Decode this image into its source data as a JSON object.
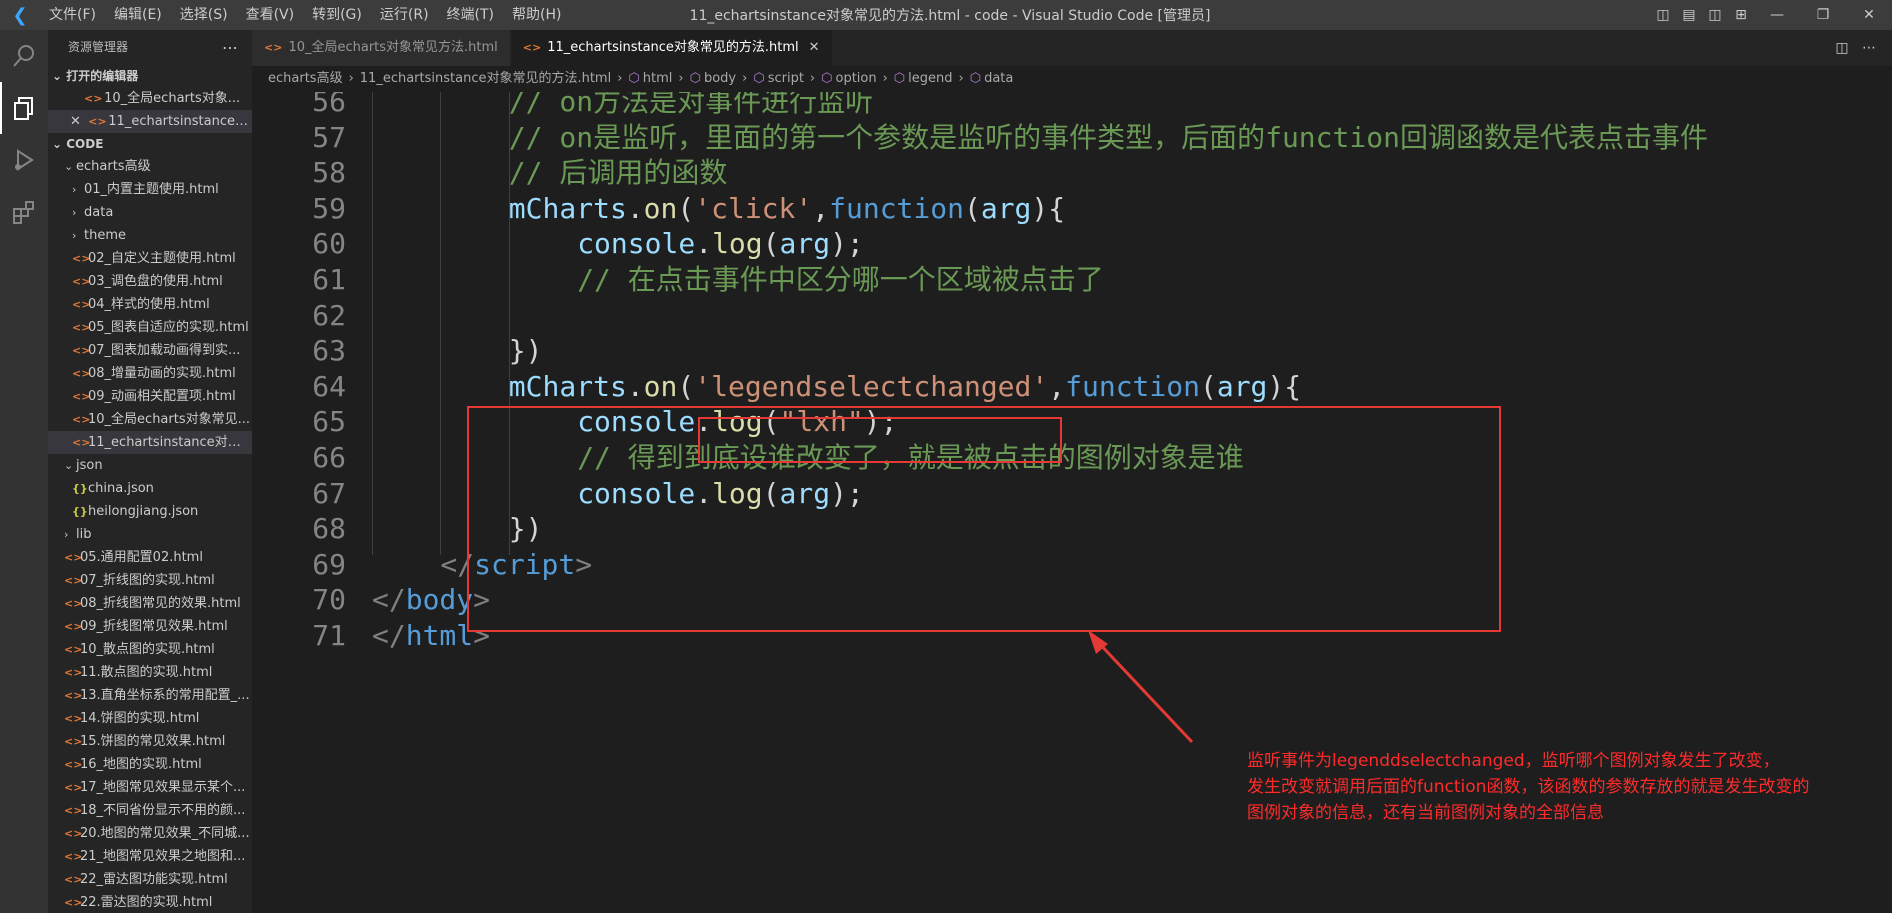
{
  "window": {
    "title": "11_echartsinstance对象常见的方法.html - code - Visual Studio Code [管理员]",
    "menu": [
      "文件(F)",
      "编辑(E)",
      "选择(S)",
      "查看(V)",
      "转到(G)",
      "运行(R)",
      "终端(T)",
      "帮助(H)"
    ]
  },
  "activity_bar": [
    "files-icon",
    "search-icon",
    "source-control-icon",
    "run-debug-icon",
    "extensions-icon"
  ],
  "sidebar": {
    "title": "资源管理器",
    "open_editors_label": "打开的编辑器",
    "open_editors": [
      "10_全局echarts对象...",
      "11_echartsinstance对..."
    ],
    "workspace_label": "CODE",
    "tree": [
      {
        "label": "echarts高级",
        "type": "folder-open",
        "indent": 1
      },
      {
        "label": "01_内置主题使用.html",
        "type": "folder-closed",
        "indent": 2
      },
      {
        "label": "data",
        "type": "folder-closed",
        "indent": 2
      },
      {
        "label": "theme",
        "type": "folder-closed",
        "indent": 2
      },
      {
        "label": "02_自定义主题使用.html",
        "type": "html",
        "indent": 2
      },
      {
        "label": "03_调色盘的使用.html",
        "type": "html",
        "indent": 2
      },
      {
        "label": "04_样式的使用.html",
        "type": "html",
        "indent": 2
      },
      {
        "label": "05_图表自适应的实现.html",
        "type": "html",
        "indent": 2
      },
      {
        "label": "07_图表加载动画得到实...",
        "type": "html",
        "indent": 2
      },
      {
        "label": "08_增量动画的实现.html",
        "type": "html",
        "indent": 2
      },
      {
        "label": "09_动画相关配置项.html",
        "type": "html",
        "indent": 2
      },
      {
        "label": "10_全局echarts对象常见...",
        "type": "html",
        "indent": 2
      },
      {
        "label": "11_echartsinstance对象...",
        "type": "html",
        "indent": 2,
        "selected": true
      },
      {
        "label": "json",
        "type": "folder-open",
        "indent": 1
      },
      {
        "label": "china.json",
        "type": "json",
        "indent": 2
      },
      {
        "label": "heilongjiang.json",
        "type": "json",
        "indent": 2
      },
      {
        "label": "lib",
        "type": "folder-closed",
        "indent": 1
      },
      {
        "label": "05.通用配置02.html",
        "type": "html",
        "indent": 1
      },
      {
        "label": "07_折线图的实现.html",
        "type": "html",
        "indent": 1
      },
      {
        "label": "08_折线图常见的效果.html",
        "type": "html",
        "indent": 1
      },
      {
        "label": "09_折线图常见效果.html",
        "type": "html",
        "indent": 1
      },
      {
        "label": "10_散点图的实现.html",
        "type": "html",
        "indent": 1
      },
      {
        "label": "11.散点图的实现.html",
        "type": "html",
        "indent": 1
      },
      {
        "label": "13.直角坐标系的常用配置_...",
        "type": "html",
        "indent": 1
      },
      {
        "label": "14.饼图的实现.html",
        "type": "html",
        "indent": 1
      },
      {
        "label": "15.饼图的常见效果.html",
        "type": "html",
        "indent": 1
      },
      {
        "label": "16_地图的实现.html",
        "type": "html",
        "indent": 1
      },
      {
        "label": "17_地图常见效果显示某个...",
        "type": "html",
        "indent": 1
      },
      {
        "label": "18_不同省份显示不用的颜...",
        "type": "html",
        "indent": 1
      },
      {
        "label": "20.地图的常见效果_不同城...",
        "type": "html",
        "indent": 1
      },
      {
        "label": "21_地图常见效果之地图和...",
        "type": "html",
        "indent": 1
      },
      {
        "label": "22_雷达图功能实现.html",
        "type": "html",
        "indent": 1
      },
      {
        "label": "22.雷达图的实现.html",
        "type": "html",
        "indent": 1
      }
    ]
  },
  "tabs": [
    {
      "label": "10_全局echarts对象常见方法.html",
      "active": false
    },
    {
      "label": "11_echartsinstance对象常见的方法.html",
      "active": true
    }
  ],
  "breadcrumb": [
    "echarts高级",
    "11_echartsinstance对象常见的方法.html",
    "html",
    "body",
    "script",
    "option",
    "legend",
    "data"
  ],
  "code_lines": [
    {
      "num": "56",
      "indent": 2,
      "tokens": [
        {
          "t": "// on方法是对事件进行监听",
          "c": "c-com"
        }
      ]
    },
    {
      "num": "57",
      "indent": 2,
      "tokens": [
        {
          "t": "// on是监听，里面的第一个参数是监听的事件类型，后面的function回调函数是代表点击事件",
          "c": "c-com"
        }
      ]
    },
    {
      "num": "58",
      "indent": 2,
      "tokens": [
        {
          "t": "// 后调用的函数",
          "c": "c-com"
        }
      ]
    },
    {
      "num": "59",
      "indent": 2,
      "tokens": [
        {
          "t": "mCharts",
          "c": "c-var"
        },
        {
          "t": ".",
          "c": "c-def"
        },
        {
          "t": "on",
          "c": "c-fn"
        },
        {
          "t": "(",
          "c": "c-def"
        },
        {
          "t": "'click'",
          "c": "c-str"
        },
        {
          "t": ",",
          "c": "c-def"
        },
        {
          "t": "function",
          "c": "c-kw"
        },
        {
          "t": "(",
          "c": "c-def"
        },
        {
          "t": "arg",
          "c": "c-var"
        },
        {
          "t": "){",
          "c": "c-def"
        }
      ]
    },
    {
      "num": "60",
      "indent": 3,
      "tokens": [
        {
          "t": "console",
          "c": "c-var"
        },
        {
          "t": ".",
          "c": "c-def"
        },
        {
          "t": "log",
          "c": "c-fn"
        },
        {
          "t": "(",
          "c": "c-def"
        },
        {
          "t": "arg",
          "c": "c-var"
        },
        {
          "t": ");",
          "c": "c-def"
        }
      ]
    },
    {
      "num": "61",
      "indent": 3,
      "tokens": [
        {
          "t": "// 在点击事件中区分哪一个区域被点击了",
          "c": "c-com"
        }
      ]
    },
    {
      "num": "62",
      "indent": 3,
      "tokens": []
    },
    {
      "num": "63",
      "indent": 2,
      "tokens": [
        {
          "t": "})",
          "c": "c-def"
        }
      ]
    },
    {
      "num": "64",
      "indent": 2,
      "tokens": [
        {
          "t": "mCharts",
          "c": "c-var"
        },
        {
          "t": ".",
          "c": "c-def"
        },
        {
          "t": "on",
          "c": "c-fn"
        },
        {
          "t": "(",
          "c": "c-def"
        },
        {
          "t": "'legendselectchanged'",
          "c": "c-str"
        },
        {
          "t": ",",
          "c": "c-def"
        },
        {
          "t": "function",
          "c": "c-kw"
        },
        {
          "t": "(",
          "c": "c-def"
        },
        {
          "t": "arg",
          "c": "c-var"
        },
        {
          "t": "){",
          "c": "c-def"
        }
      ]
    },
    {
      "num": "65",
      "indent": 3,
      "tokens": [
        {
          "t": "console",
          "c": "c-var"
        },
        {
          "t": ".",
          "c": "c-def"
        },
        {
          "t": "log",
          "c": "c-fn"
        },
        {
          "t": "(",
          "c": "c-def"
        },
        {
          "t": "\"lxh\"",
          "c": "c-str"
        },
        {
          "t": ");",
          "c": "c-def"
        }
      ]
    },
    {
      "num": "66",
      "indent": 3,
      "tokens": [
        {
          "t": "// 得到到底设谁改变了，就是被点击的图例对象是谁",
          "c": "c-com"
        }
      ]
    },
    {
      "num": "67",
      "indent": 3,
      "tokens": [
        {
          "t": "console",
          "c": "c-var"
        },
        {
          "t": ".",
          "c": "c-def"
        },
        {
          "t": "log",
          "c": "c-fn"
        },
        {
          "t": "(",
          "c": "c-def"
        },
        {
          "t": "arg",
          "c": "c-var"
        },
        {
          "t": ");",
          "c": "c-def"
        }
      ]
    },
    {
      "num": "68",
      "indent": 2,
      "tokens": [
        {
          "t": "})",
          "c": "c-def"
        }
      ]
    },
    {
      "num": "69",
      "indent": 1,
      "tokens": [
        {
          "t": "</",
          "c": "c-tag"
        },
        {
          "t": "script",
          "c": "c-kw"
        },
        {
          "t": ">",
          "c": "c-tag"
        }
      ]
    },
    {
      "num": "70",
      "indent": 0,
      "tokens": [
        {
          "t": "</",
          "c": "c-tag"
        },
        {
          "t": "body",
          "c": "c-kw"
        },
        {
          "t": ">",
          "c": "c-tag"
        }
      ]
    },
    {
      "num": "71",
      "indent": 0,
      "tokens": [
        {
          "t": "</",
          "c": "c-tag"
        },
        {
          "t": "html",
          "c": "c-kw"
        },
        {
          "t": ">",
          "c": "c-tag"
        }
      ]
    }
  ],
  "annotation": {
    "color": "#e53935",
    "lines": [
      "监听事件为legenddselectchanged，监听哪个图例对象发生了改变，",
      "发生改变就调用后面的function函数，该函数的参数存放的就是发生改变的",
      "图例对象的信息，还有当前图例对象的全部信息"
    ]
  }
}
